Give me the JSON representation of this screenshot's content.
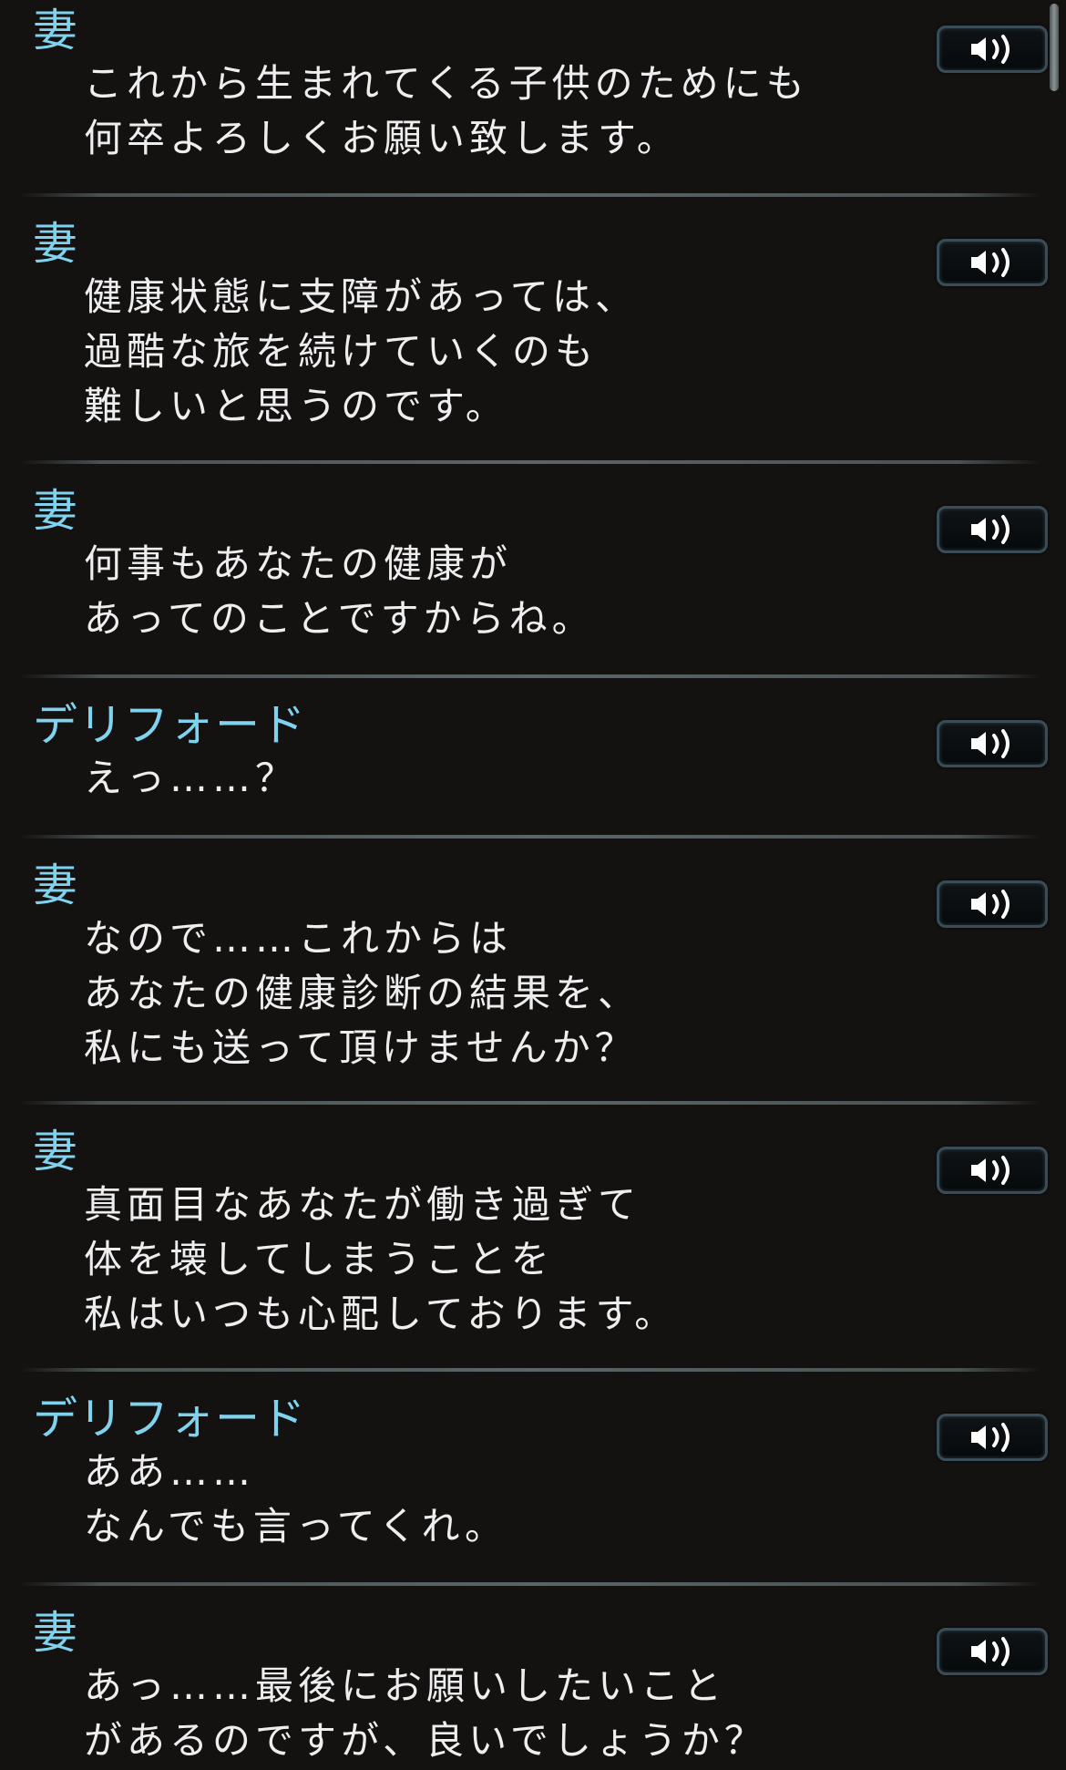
{
  "entries": [
    {
      "speaker": "妻",
      "lines": [
        "これから生まれてくる子供のためにも",
        "何卒よろしくお願い致します。"
      ]
    },
    {
      "speaker": "妻",
      "lines": [
        "健康状態に支障があっては、",
        "過酷な旅を続けていくのも",
        "難しいと思うのです。"
      ]
    },
    {
      "speaker": "妻",
      "lines": [
        "何事もあなたの健康が",
        "あってのことですからね。"
      ]
    },
    {
      "speaker": "デリフォード",
      "lines": [
        "えっ……？"
      ]
    },
    {
      "speaker": "妻",
      "lines": [
        "なので……これからは",
        "あなたの健康診断の結果を、",
        "私にも送って頂けませんか？"
      ]
    },
    {
      "speaker": "妻",
      "lines": [
        "真面目なあなたが働き過ぎて",
        "体を壊してしまうことを",
        "私はいつも心配しております。"
      ]
    },
    {
      "speaker": "デリフォード",
      "lines": [
        "ああ……",
        "なんでも言ってくれ。"
      ]
    },
    {
      "speaker": "妻",
      "lines": [
        "あっ……最後にお願いしたいこと",
        "があるのですが、良いでしょうか？"
      ]
    }
  ],
  "voice_button_icon": "speaker-voice-icon",
  "colors": {
    "background": "#141111",
    "speaker_name": "#7fd3ee",
    "dialogue_text": "#eeeeee",
    "divider": "#5b6466"
  }
}
